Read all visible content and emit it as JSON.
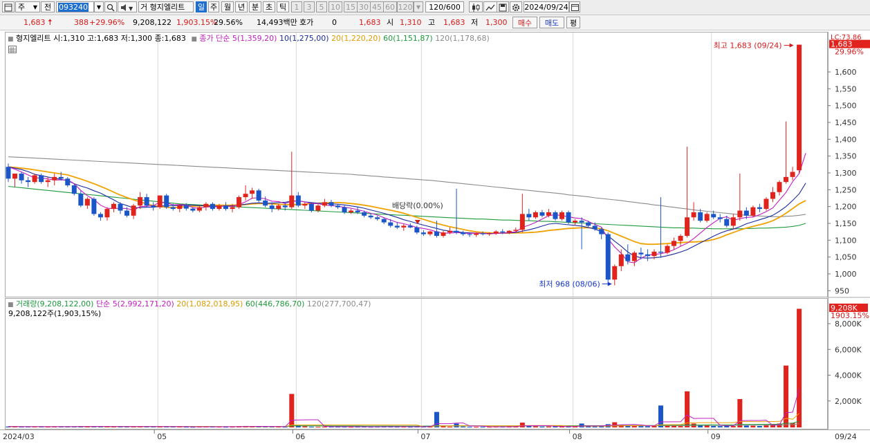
{
  "toolbar": {
    "market_label": "주",
    "prev_label": "전",
    "code": "093240",
    "stock_name": "형지엘리트",
    "name_prefix": "거",
    "periods": [
      "일",
      "주",
      "월",
      "년",
      "분",
      "초",
      "틱"
    ],
    "selected_period": "일",
    "intervals": [
      "1",
      "3",
      "5",
      "10",
      "15",
      "30",
      "45",
      "60",
      "120"
    ],
    "count": "120",
    "count_total": "/600",
    "date": "2024/09/24"
  },
  "quote": {
    "price": "1,683",
    "change": "388",
    "change_pct": "+29.96%",
    "volume": "9,208,122",
    "volume_ratio": "1,903.15%",
    "turnover_rate": "29.56%",
    "amount": "14,493백만",
    "hoga_label": "호가",
    "hoga_value": "0",
    "hoga_price": "1,683",
    "open_label": "시",
    "open": "1,310",
    "high_label": "고",
    "high": "1,683",
    "low_label": "저",
    "low": "1,300",
    "buy_label": "매수",
    "sell_label": "매도",
    "eval_label": "평"
  },
  "legend": {
    "stock": "형지엘리트 시:1,310 고:1,683 저:1,300 종:1,683",
    "ma_title": "종가 단순",
    "ma5": "5(1,359,20)",
    "ma10": "10(1,275,00)",
    "ma20": "20(1,220,20)",
    "ma60": "60(1,151,87)",
    "ma120": "120(1,178,68)",
    "vol": "거래량(9,208,122,00)",
    "vma_title": "단순",
    "vma5": "5(2,992,171,20)",
    "vma20": "20(1,082,018,95)",
    "vma60": "60(446,786,70)",
    "vma120": "120(277,700,47)",
    "vol_sub": "9,208,122주(1,903,15%)"
  },
  "annotations": {
    "high": "최고 1,683 (09/24)",
    "low": "최저 968 (08/06)",
    "dividend": "배당락(0.00%)",
    "lc": "LC:73.86",
    "price_tag": "1,683",
    "pct_tag": "29.96%",
    "vol_tag": "9,208K",
    "vol_pct_tag": "1903.15%"
  },
  "colors": {
    "up": "#e0231c",
    "down": "#1a56c8",
    "ma5": "#c21dc2",
    "ma10": "#1a2a9e",
    "ma20": "#f0a200",
    "ma60": "#1d9a3a",
    "ma120": "#8a8a8a"
  },
  "chart_data": {
    "type": "candlestick",
    "x_axis_labels": [
      "2024/03",
      "05",
      "06",
      "07",
      "08",
      "09",
      "09/24"
    ],
    "price_ticks": [
      950,
      1000,
      1050,
      1100,
      1150,
      1200,
      1250,
      1300,
      1350,
      1400,
      1450,
      1500,
      1550,
      1600
    ],
    "volume_ticks": [
      "2,000K",
      "4,000K",
      "6,000K",
      "8,000K"
    ],
    "ohlc": [
      [
        1320,
        1330,
        1275,
        1285
      ],
      [
        1285,
        1300,
        1260,
        1300
      ],
      [
        1300,
        1305,
        1270,
        1280
      ],
      [
        1280,
        1290,
        1260,
        1275
      ],
      [
        1275,
        1300,
        1270,
        1295
      ],
      [
        1295,
        1300,
        1270,
        1275
      ],
      [
        1275,
        1290,
        1260,
        1280
      ],
      [
        1280,
        1300,
        1265,
        1290
      ],
      [
        1290,
        1305,
        1280,
        1285
      ],
      [
        1285,
        1290,
        1260,
        1265
      ],
      [
        1265,
        1270,
        1235,
        1240
      ],
      [
        1240,
        1250,
        1200,
        1205
      ],
      [
        1205,
        1230,
        1195,
        1225
      ],
      [
        1225,
        1230,
        1175,
        1180
      ],
      [
        1180,
        1185,
        1160,
        1170
      ],
      [
        1170,
        1200,
        1160,
        1195
      ],
      [
        1195,
        1215,
        1185,
        1210
      ],
      [
        1210,
        1215,
        1180,
        1190
      ],
      [
        1190,
        1200,
        1170,
        1175
      ],
      [
        1175,
        1210,
        1165,
        1205
      ],
      [
        1205,
        1245,
        1195,
        1230
      ],
      [
        1230,
        1240,
        1200,
        1205
      ],
      [
        1205,
        1215,
        1190,
        1200
      ],
      [
        1200,
        1235,
        1195,
        1235
      ],
      [
        1235,
        1240,
        1195,
        1200
      ],
      [
        1200,
        1210,
        1190,
        1195
      ],
      [
        1195,
        1210,
        1185,
        1205
      ],
      [
        1205,
        1212,
        1190,
        1196
      ],
      [
        1196,
        1200,
        1185,
        1190
      ],
      [
        1190,
        1205,
        1185,
        1200
      ],
      [
        1200,
        1215,
        1190,
        1210
      ],
      [
        1210,
        1215,
        1190,
        1195
      ],
      [
        1195,
        1210,
        1190,
        1205
      ],
      [
        1205,
        1215,
        1190,
        1195
      ],
      [
        1195,
        1210,
        1185,
        1200
      ],
      [
        1200,
        1235,
        1195,
        1230
      ],
      [
        1230,
        1265,
        1220,
        1240
      ],
      [
        1240,
        1258,
        1225,
        1250
      ],
      [
        1250,
        1255,
        1215,
        1220
      ],
      [
        1220,
        1232,
        1200,
        1205
      ],
      [
        1205,
        1215,
        1185,
        1195
      ],
      [
        1195,
        1210,
        1190,
        1205
      ],
      [
        1205,
        1215,
        1190,
        1200
      ],
      [
        1200,
        1365,
        1195,
        1235
      ],
      [
        1235,
        1245,
        1200,
        1205
      ],
      [
        1205,
        1215,
        1195,
        1210
      ],
      [
        1210,
        1212,
        1185,
        1190
      ],
      [
        1190,
        1210,
        1185,
        1205
      ],
      [
        1205,
        1225,
        1200,
        1215
      ],
      [
        1215,
        1222,
        1200,
        1205
      ],
      [
        1205,
        1210,
        1195,
        1200
      ],
      [
        1200,
        1205,
        1180,
        1185
      ],
      [
        1185,
        1195,
        1180,
        1190
      ],
      [
        1190,
        1200,
        1180,
        1185
      ],
      [
        1185,
        1190,
        1170,
        1175
      ],
      [
        1175,
        1182,
        1165,
        1170
      ],
      [
        1170,
        1175,
        1160,
        1165
      ],
      [
        1165,
        1170,
        1150,
        1155
      ],
      [
        1155,
        1165,
        1140,
        1145
      ],
      [
        1145,
        1155,
        1135,
        1140
      ],
      [
        1140,
        1150,
        1130,
        1145
      ],
      [
        1145,
        1152,
        1138,
        1140
      ],
      [
        1140,
        1145,
        1120,
        1125
      ],
      [
        1125,
        1132,
        1115,
        1120
      ],
      [
        1120,
        1130,
        1115,
        1128
      ],
      [
        1128,
        1160,
        1110,
        1115
      ],
      [
        1115,
        1130,
        1110,
        1125
      ],
      [
        1125,
        1140,
        1120,
        1130
      ],
      [
        1130,
        1255,
        1120,
        1125
      ],
      [
        1125,
        1130,
        1115,
        1120
      ],
      [
        1120,
        1125,
        1112,
        1118
      ],
      [
        1118,
        1125,
        1112,
        1122
      ],
      [
        1122,
        1128,
        1116,
        1120
      ],
      [
        1120,
        1125,
        1115,
        1122
      ],
      [
        1122,
        1132,
        1118,
        1128
      ],
      [
        1128,
        1135,
        1120,
        1125
      ],
      [
        1125,
        1132,
        1120,
        1130
      ],
      [
        1130,
        1140,
        1125,
        1133
      ],
      [
        1133,
        1240,
        1125,
        1180
      ],
      [
        1180,
        1195,
        1160,
        1170
      ],
      [
        1170,
        1190,
        1165,
        1185
      ],
      [
        1185,
        1192,
        1170,
        1175
      ],
      [
        1175,
        1195,
        1170,
        1185
      ],
      [
        1185,
        1190,
        1160,
        1165
      ],
      [
        1165,
        1190,
        1160,
        1185
      ],
      [
        1185,
        1190,
        1150,
        1155
      ],
      [
        1155,
        1165,
        1145,
        1160
      ],
      [
        1160,
        1170,
        1075,
        1155
      ],
      [
        1155,
        1160,
        1140,
        1145
      ],
      [
        1145,
        1155,
        1130,
        1135
      ],
      [
        1135,
        1140,
        1105,
        1120
      ],
      [
        1120,
        1125,
        975,
        985
      ],
      [
        985,
        1030,
        968,
        1025
      ],
      [
        1025,
        1075,
        1010,
        1060
      ],
      [
        1060,
        1090,
        1030,
        1040
      ],
      [
        1040,
        1070,
        1025,
        1065
      ],
      [
        1065,
        1080,
        1045,
        1060
      ],
      [
        1060,
        1075,
        1040,
        1055
      ],
      [
        1055,
        1075,
        1045,
        1068
      ],
      [
        1068,
        1230,
        1050,
        1065
      ],
      [
        1065,
        1090,
        1060,
        1085
      ],
      [
        1085,
        1110,
        1075,
        1100
      ],
      [
        1100,
        1120,
        1085,
        1115
      ],
      [
        1115,
        1380,
        1110,
        1170
      ],
      [
        1170,
        1215,
        1160,
        1185
      ],
      [
        1185,
        1195,
        1155,
        1160
      ],
      [
        1160,
        1185,
        1155,
        1180
      ],
      [
        1180,
        1190,
        1165,
        1170
      ],
      [
        1170,
        1180,
        1155,
        1165
      ],
      [
        1165,
        1175,
        1140,
        1145
      ],
      [
        1145,
        1180,
        1135,
        1170
      ],
      [
        1170,
        1300,
        1160,
        1190
      ],
      [
        1190,
        1200,
        1165,
        1175
      ],
      [
        1175,
        1205,
        1170,
        1200
      ],
      [
        1200,
        1210,
        1185,
        1195
      ],
      [
        1195,
        1230,
        1190,
        1225
      ],
      [
        1225,
        1260,
        1215,
        1245
      ],
      [
        1245,
        1280,
        1235,
        1275
      ],
      [
        1275,
        1455,
        1270,
        1290
      ],
      [
        1290,
        1320,
        1280,
        1305
      ],
      [
        1310,
        1683,
        1300,
        1683
      ]
    ],
    "volume_k": [
      70,
      60,
      50,
      60,
      65,
      55,
      50,
      65,
      60,
      55,
      70,
      90,
      70,
      80,
      60,
      75,
      70,
      60,
      55,
      70,
      80,
      65,
      55,
      70,
      60,
      55,
      55,
      45,
      40,
      50,
      60,
      55,
      50,
      45,
      50,
      90,
      110,
      80,
      70,
      60,
      50,
      50,
      45,
      2600,
      160,
      80,
      55,
      50,
      60,
      55,
      50,
      60,
      45,
      50,
      55,
      45,
      50,
      60,
      55,
      50,
      55,
      45,
      60,
      55,
      50,
      1200,
      80,
      60,
      300,
      70,
      50,
      45,
      50,
      45,
      60,
      55,
      50,
      60,
      370,
      100,
      80,
      60,
      70,
      90,
      65,
      60,
      55,
      300,
      80,
      70,
      80,
      250,
      400,
      200,
      150,
      120,
      100,
      90,
      130,
      1700,
      120,
      140,
      100,
      2800,
      300,
      180,
      140,
      110,
      100,
      120,
      100,
      2200,
      140,
      130,
      110,
      200,
      250,
      300,
      4800,
      350,
      9208
    ],
    "ma5": [
      1320,
      1313,
      1305,
      1296,
      1287,
      1287,
      1284,
      1281,
      1281,
      1281,
      1270,
      1250,
      1234,
      1223,
      1206,
      1197,
      1196,
      1197,
      1196,
      1191,
      1202,
      1203,
      1205,
      1215,
      1213,
      1207,
      1208,
      1207,
      1199,
      1197,
      1201,
      1201,
      1202,
      1204,
      1202,
      1208,
      1216,
      1227,
      1228,
      1225,
      1218,
      1217,
      1211,
      1218,
      1219,
      1216,
      1211,
      1211,
      1206,
      1205,
      1203,
      1200,
      1197,
      1193,
      1188,
      1182,
      1177,
      1169,
      1162,
      1155,
      1151,
      1146,
      1140,
      1137,
      1133,
      1127,
      1123,
      1123,
      1125,
      1123,
      1122,
      1123,
      1122,
      1121,
      1122,
      1123,
      1125,
      1127,
      1140,
      1147,
      1155,
      1165,
      1175,
      1178,
      1175,
      1172,
      1168,
      1166,
      1158,
      1149,
      1141,
      1106,
      1082,
      1063,
      1038,
      1035,
      1049,
      1058,
      1060,
      1062,
      1066,
      1074,
      1084,
      1093,
      1107,
      1123,
      1140,
      1154,
      1167,
      1172,
      1161,
      1166,
      1170,
      1171,
      1178,
      1187,
      1198,
      1221,
      1244,
      1276,
      1300,
      1361
    ],
    "ma10": [
      1320,
      1316,
      1312,
      1306,
      1298,
      1294,
      1290,
      1286,
      1283,
      1279,
      1270,
      1263,
      1257,
      1249,
      1242,
      1232,
      1222,
      1211,
      1205,
      1198,
      1199,
      1200,
      1200,
      1203,
      1205,
      1205,
      1205,
      1206,
      1206,
      1205,
      1204,
      1203,
      1203,
      1204,
      1204,
      1206,
      1209,
      1212,
      1213,
      1212,
      1212,
      1214,
      1215,
      1218,
      1219,
      1216,
      1214,
      1212,
      1211,
      1210,
      1209,
      1207,
      1204,
      1201,
      1197,
      1192,
      1187,
      1182,
      1176,
      1170,
      1163,
      1158,
      1152,
      1147,
      1142,
      1137,
      1132,
      1129,
      1127,
      1125,
      1124,
      1123,
      1122,
      1122,
      1122,
      1123,
      1124,
      1125,
      1129,
      1133,
      1138,
      1144,
      1150,
      1152,
      1150,
      1148,
      1146,
      1144,
      1140,
      1135,
      1128,
      1115,
      1099,
      1084,
      1067,
      1055,
      1050,
      1049,
      1050,
      1052,
      1056,
      1061,
      1067,
      1074,
      1084,
      1094,
      1104,
      1114,
      1123,
      1130,
      1135,
      1142,
      1151,
      1157,
      1163,
      1169,
      1176,
      1188,
      1202,
      1220,
      1240,
      1272
    ],
    "ma20": [
      1320,
      1318,
      1316,
      1314,
      1311,
      1308,
      1305,
      1302,
      1299,
      1296,
      1290,
      1284,
      1277,
      1270,
      1262,
      1254,
      1245,
      1236,
      1229,
      1222,
      1216,
      1210,
      1205,
      1202,
      1200,
      1199,
      1200,
      1202,
      1203,
      1204,
      1205,
      1206,
      1206,
      1206,
      1206,
      1207,
      1208,
      1210,
      1211,
      1211,
      1210,
      1209,
      1208,
      1208,
      1208,
      1209,
      1211,
      1212,
      1213,
      1214,
      1214,
      1213,
      1211,
      1209,
      1206,
      1203,
      1199,
      1195,
      1191,
      1187,
      1182,
      1176,
      1170,
      1164,
      1158,
      1152,
      1147,
      1142,
      1138,
      1134,
      1130,
      1127,
      1125,
      1124,
      1123,
      1123,
      1123,
      1124,
      1124,
      1125,
      1126,
      1128,
      1131,
      1133,
      1135,
      1137,
      1138,
      1139,
      1139,
      1138,
      1136,
      1130,
      1122,
      1114,
      1106,
      1098,
      1092,
      1090,
      1090,
      1091,
      1092,
      1094,
      1095,
      1096,
      1097,
      1098,
      1100,
      1104,
      1110,
      1118,
      1125,
      1132,
      1138,
      1143,
      1148,
      1153,
      1160,
      1170,
      1182,
      1196,
      1210,
      1220
    ],
    "ma60": [
      1262,
      1260,
      1258,
      1256,
      1254,
      1252,
      1250,
      1248,
      1246,
      1244,
      1242,
      1240,
      1238,
      1236,
      1234,
      1232,
      1230,
      1228,
      1226,
      1224,
      1222,
      1220,
      1218,
      1216,
      1214,
      1212,
      1210,
      1209,
      1208,
      1207,
      1206,
      1205,
      1204,
      1203,
      1202,
      1201,
      1200,
      1199,
      1198,
      1197,
      1196,
      1195,
      1194,
      1193,
      1192,
      1191,
      1190,
      1189,
      1188,
      1187,
      1186,
      1185,
      1184,
      1183,
      1182,
      1181,
      1180,
      1179,
      1178,
      1177,
      1176,
      1175,
      1174,
      1173,
      1172,
      1171,
      1170,
      1169,
      1168,
      1167,
      1166,
      1165,
      1165,
      1164,
      1163,
      1162,
      1162,
      1161,
      1160,
      1160,
      1159,
      1158,
      1158,
      1157,
      1156,
      1155,
      1154,
      1153,
      1152,
      1151,
      1150,
      1149,
      1148,
      1147,
      1146,
      1145,
      1144,
      1143,
      1142,
      1141,
      1140,
      1139,
      1139,
      1138,
      1138,
      1137,
      1137,
      1136,
      1136,
      1136,
      1136,
      1136,
      1137,
      1137,
      1138,
      1138,
      1139,
      1140,
      1141,
      1143,
      1146,
      1152
    ],
    "ma120": [
      1350,
      1349,
      1348,
      1347,
      1346,
      1345,
      1344,
      1343,
      1342,
      1341,
      1340,
      1339,
      1338,
      1337,
      1336,
      1335,
      1334,
      1333,
      1332,
      1331,
      1330,
      1329,
      1328,
      1327,
      1326,
      1325,
      1324,
      1323,
      1322,
      1321,
      1320,
      1319,
      1318,
      1317,
      1316,
      1315,
      1314,
      1313,
      1312,
      1311,
      1310,
      1309,
      1308,
      1307,
      1306,
      1305,
      1304,
      1303,
      1302,
      1301,
      1300,
      1299,
      1298,
      1296,
      1295,
      1293,
      1292,
      1290,
      1289,
      1287,
      1286,
      1284,
      1283,
      1281,
      1280,
      1278,
      1276,
      1274,
      1272,
      1270,
      1268,
      1266,
      1264,
      1262,
      1260,
      1258,
      1256,
      1254,
      1252,
      1250,
      1248,
      1246,
      1244,
      1242,
      1240,
      1237,
      1235,
      1233,
      1231,
      1228,
      1226,
      1224,
      1222,
      1220,
      1217,
      1215,
      1212,
      1210,
      1207,
      1205,
      1202,
      1200,
      1197,
      1195,
      1192,
      1190,
      1188,
      1186,
      1184,
      1182,
      1180,
      1178,
      1176,
      1175,
      1174,
      1173,
      1172,
      1172,
      1173,
      1174,
      1176,
      1179
    ]
  }
}
